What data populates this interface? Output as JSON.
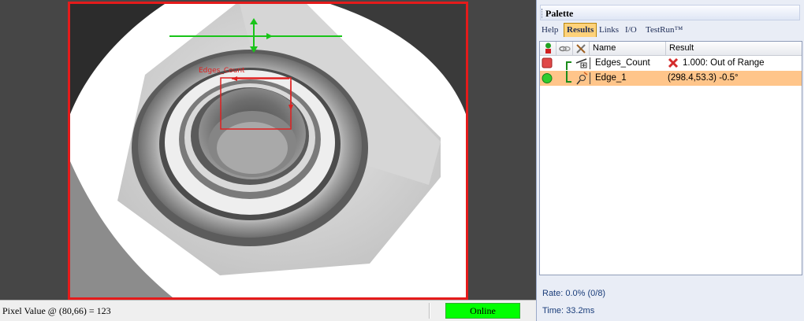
{
  "viewer": {
    "roi_label": "Edges_Count"
  },
  "statusbar": {
    "pixel_value": "Pixel Value @ (80,66) = 123",
    "online_label": "Online"
  },
  "palette": {
    "title": "Palette",
    "tabs": [
      {
        "label": "Help",
        "active": false
      },
      {
        "label": "Results",
        "active": true
      },
      {
        "label": "Links",
        "active": false
      },
      {
        "label": "I/O",
        "active": false
      },
      {
        "label": "TestRun™",
        "active": false
      }
    ],
    "columns": {
      "name": "Name",
      "result": "Result"
    },
    "rows": [
      {
        "status": "fail",
        "name": "Edges_Count",
        "result": "1.000: Out of Range",
        "selected": false
      },
      {
        "status": "pass",
        "name": "Edge_1",
        "result": "(298.4,53.3) -0.5°",
        "selected": true
      }
    ],
    "rate": "Rate: 0.0% (0/8)",
    "time": "Time: 33.2ms"
  },
  "colors": {
    "frame_border": "#e51b1b",
    "online_bg": "#00ff00",
    "selected_row": "#ffc58a",
    "active_tab": "#ffd27a"
  }
}
